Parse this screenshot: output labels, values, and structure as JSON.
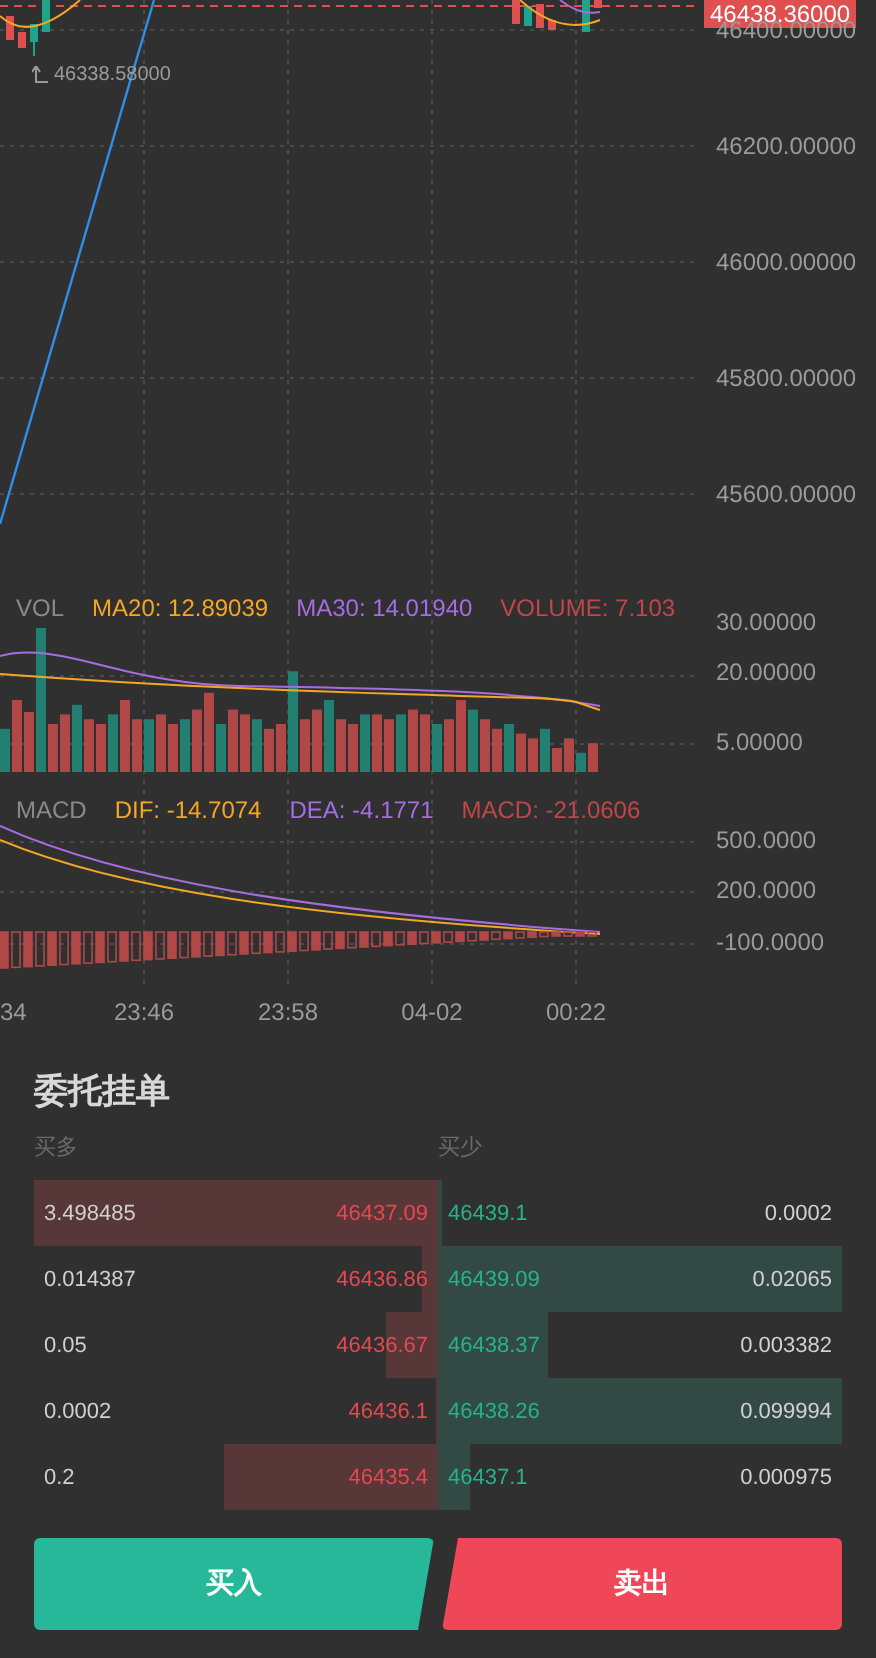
{
  "price_chart": {
    "ticks": [
      "46400.00000",
      "46200.00000",
      "46000.00000",
      "45800.00000",
      "45600.00000"
    ],
    "current_price": "46438.36000",
    "low_marker": "46338.58000"
  },
  "volume_chart": {
    "legend": [
      {
        "label": "VOL",
        "color": "#8a8a8a"
      },
      {
        "label": "MA20: 12.89039",
        "color": "#f5a623"
      },
      {
        "label": "MA30: 14.01940",
        "color": "#a56de2"
      },
      {
        "label": "VOLUME: 7.103",
        "color": "#c0464a"
      }
    ],
    "ticks": [
      "30.00000",
      "20.00000",
      "5.00000"
    ]
  },
  "macd_chart": {
    "legend": [
      {
        "label": "MACD",
        "color": "#8a8a8a"
      },
      {
        "label": "DIF: -14.7074",
        "color": "#f5a623"
      },
      {
        "label": "DEA: -4.1771",
        "color": "#a56de2"
      },
      {
        "label": "MACD: -21.0606",
        "color": "#c0464a"
      }
    ],
    "ticks": [
      "500.0000",
      "200.0000",
      "-100.0000"
    ]
  },
  "time_axis": [
    "34",
    "23:46",
    "23:58",
    "04-02",
    "00:22"
  ],
  "order_book": {
    "title": "委托挂单",
    "bid_header": "买多",
    "ask_header": "买少",
    "rows": [
      {
        "bid": {
          "amount": "3.498485",
          "price": "46437.09"
        },
        "ask": {
          "price": "46439.1",
          "amount": "0.0002"
        }
      },
      {
        "bid": {
          "amount": "0.014387",
          "price": "46436.86"
        },
        "ask": {
          "price": "46439.09",
          "amount": "0.02065"
        }
      },
      {
        "bid": {
          "amount": "0.05",
          "price": "46436.67"
        },
        "ask": {
          "price": "46438.37",
          "amount": "0.003382"
        }
      },
      {
        "bid": {
          "amount": "0.0002",
          "price": "46436.1"
        },
        "ask": {
          "price": "46438.26",
          "amount": "0.099994"
        }
      },
      {
        "bid": {
          "amount": "0.2",
          "price": "46435.4"
        },
        "ask": {
          "price": "46437.1",
          "amount": "0.000975"
        }
      }
    ]
  },
  "actions": [
    {
      "label": "买入",
      "kind": "buy"
    },
    {
      "label": "卖出",
      "kind": "sell"
    }
  ]
}
